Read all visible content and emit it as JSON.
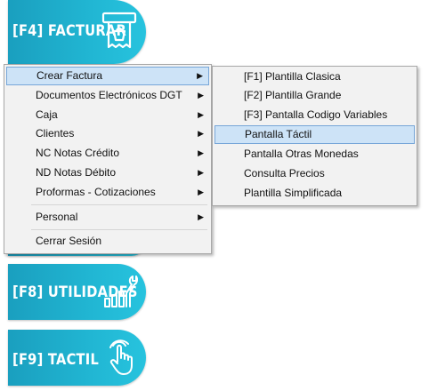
{
  "tiles": {
    "facturar": {
      "label": "[F4] FACTURAR",
      "icon": "cash-register-icon"
    },
    "utilidades": {
      "label": "[F8] UTILIDADES",
      "icon": "wrench-chart-icon"
    },
    "tactil": {
      "label": "[F9] TACTIL",
      "icon": "touch-hand-icon"
    }
  },
  "main_menu": {
    "items": [
      {
        "label": "Crear Factura",
        "has_submenu": true,
        "highlighted": true
      },
      {
        "label": "Documentos Electrónicos DGT",
        "has_submenu": true
      },
      {
        "label": "Caja",
        "has_submenu": true
      },
      {
        "label": "Clientes",
        "has_submenu": true
      },
      {
        "label": "NC Notas Crédito",
        "has_submenu": true
      },
      {
        "label": "ND Notas Débito",
        "has_submenu": true
      },
      {
        "label": "Proformas - Cotizaciones",
        "has_submenu": true
      },
      {
        "label": "Personal",
        "has_submenu": true
      },
      {
        "label": "Cerrar Sesión",
        "has_submenu": false
      }
    ]
  },
  "sub_menu": {
    "items": [
      {
        "label": "[F1] Plantilla Clasica"
      },
      {
        "label": "[F2] Plantilla Grande"
      },
      {
        "label": "[F3] Pantalla Codigo Variables"
      },
      {
        "label": "Pantalla Táctil",
        "highlighted": true
      },
      {
        "label": "Pantalla Otras Monedas"
      },
      {
        "label": "Consulta Precios"
      },
      {
        "label": "Plantilla Simplificada"
      }
    ]
  },
  "colors": {
    "tile": "#21b6d3",
    "highlight": "#cde3f7",
    "highlight_border": "#77a6d8"
  }
}
